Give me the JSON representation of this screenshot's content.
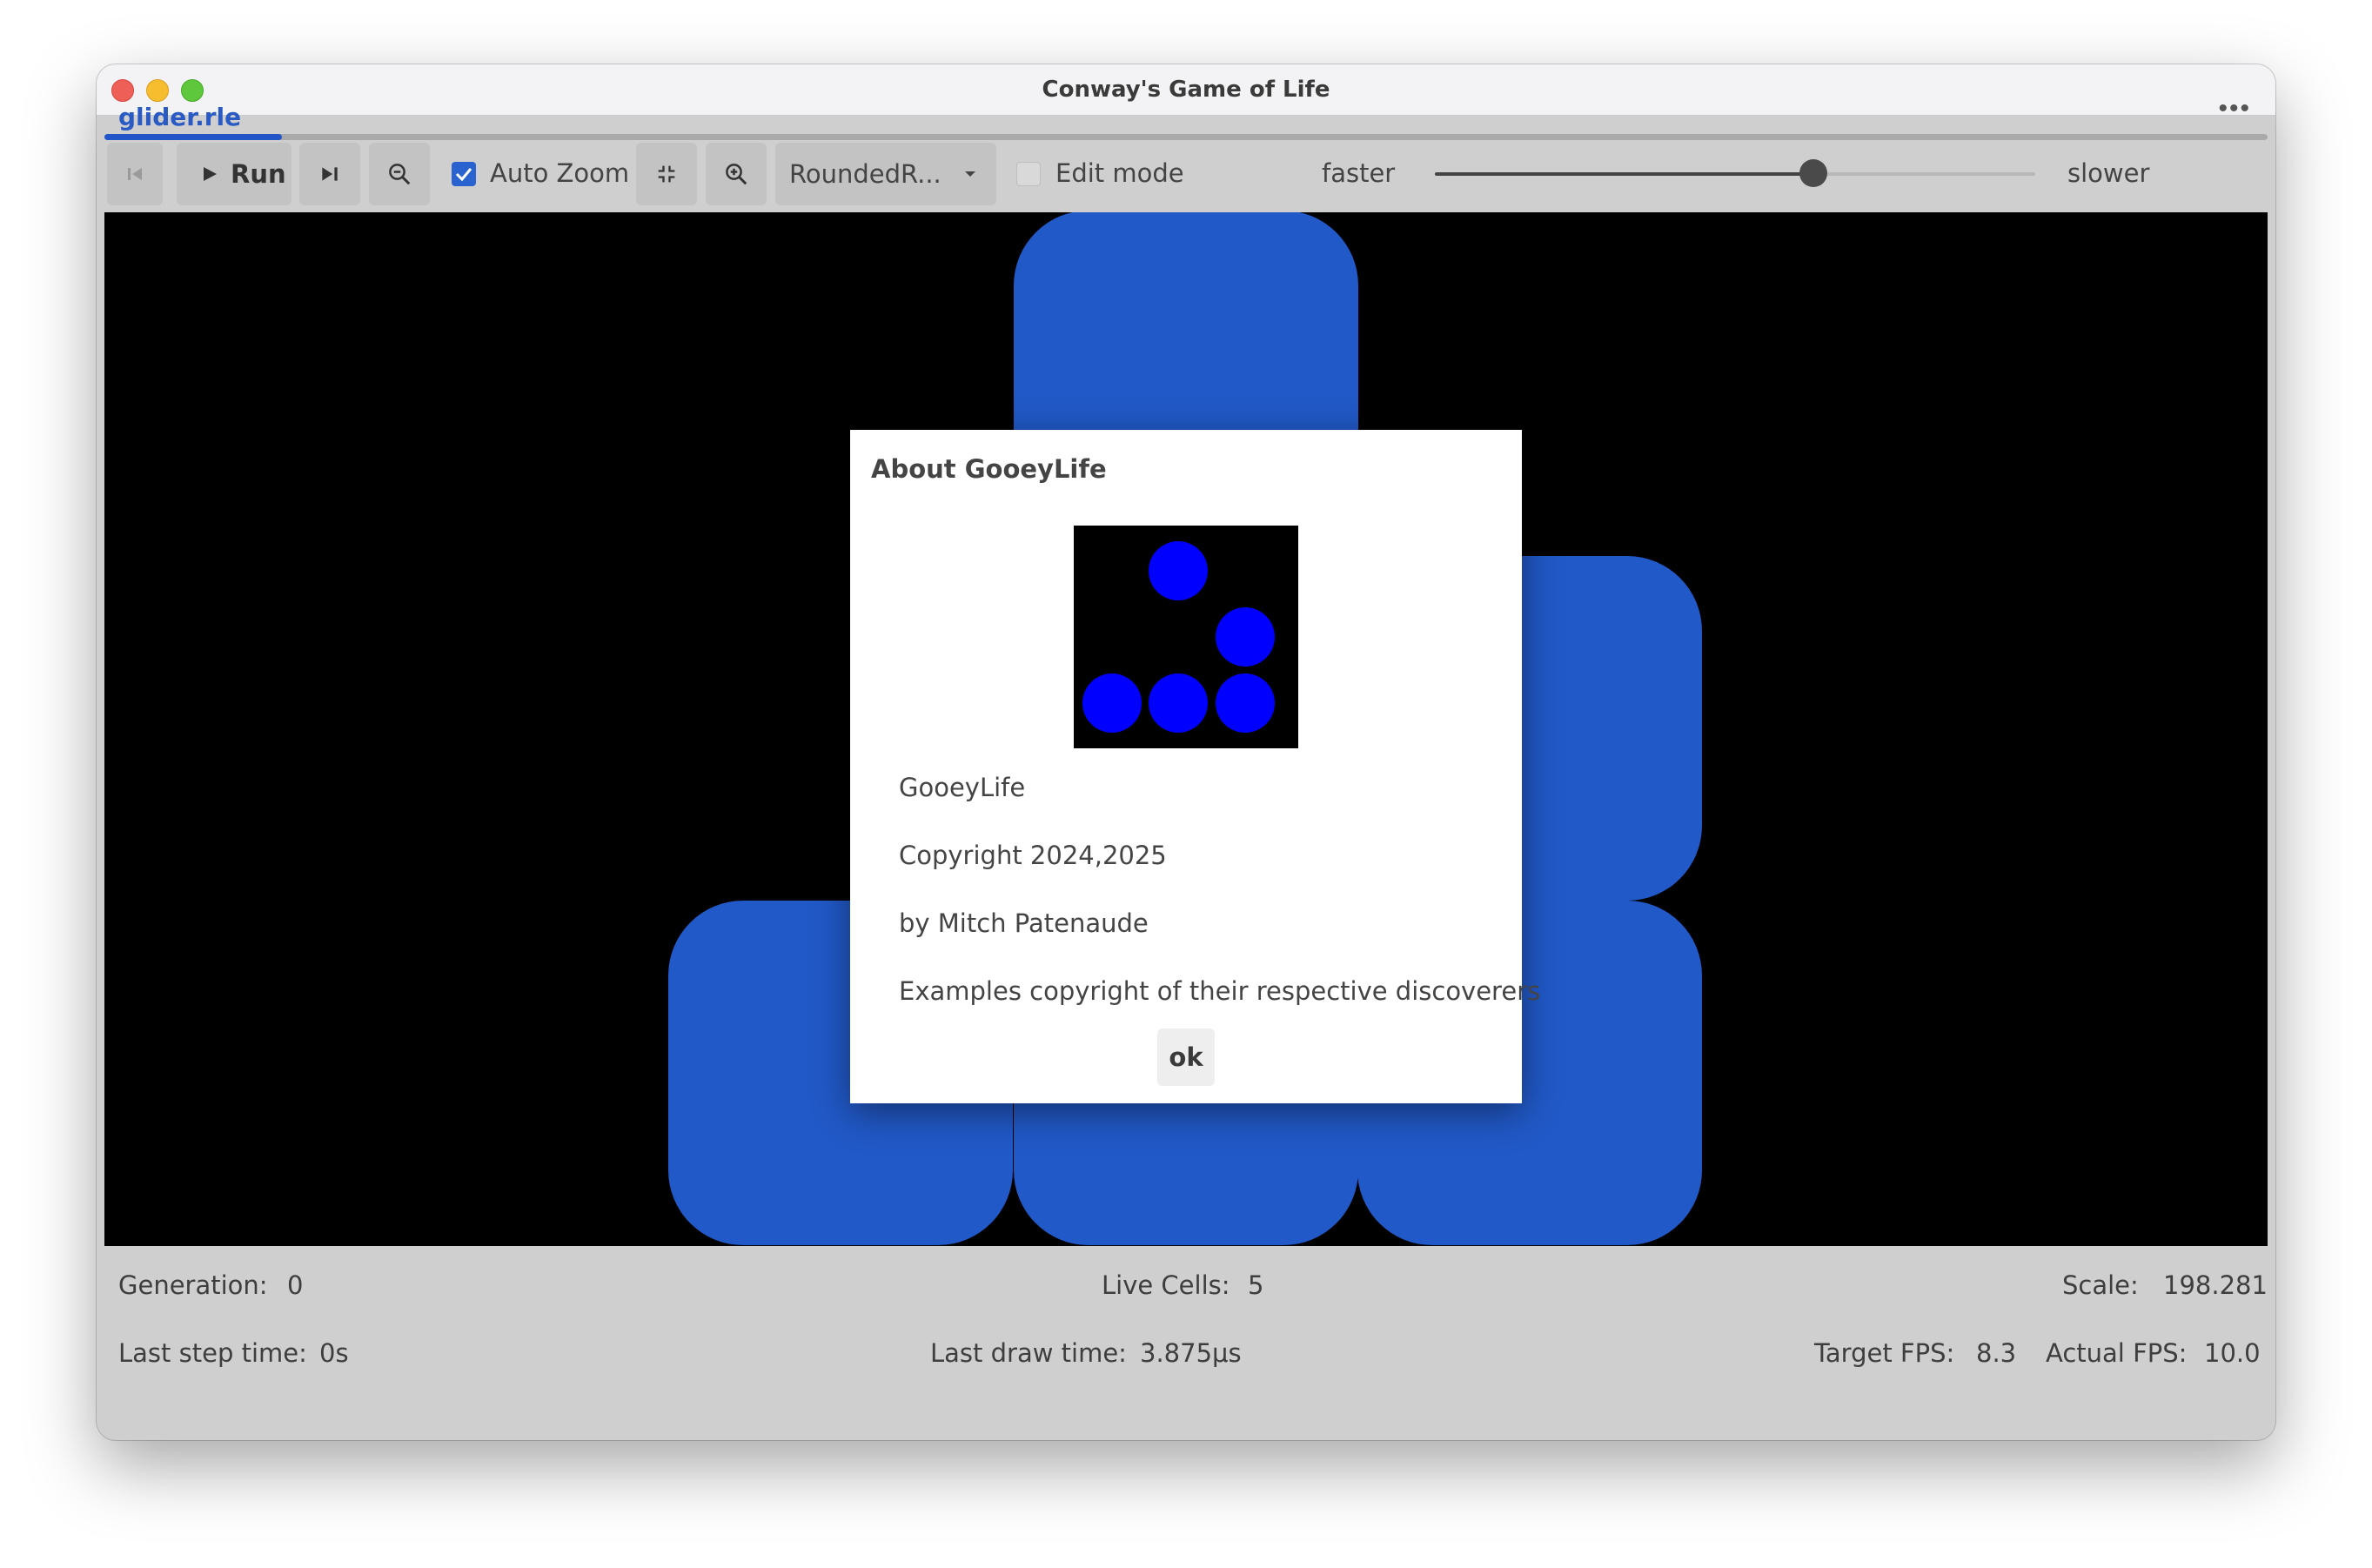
{
  "window": {
    "title": "Conway's Game of Life"
  },
  "tab": {
    "label": "glider.rle",
    "more_icon": "more-horizontal-icon"
  },
  "toolbar": {
    "run_label": "Run",
    "auto_zoom_label": "Auto Zoom",
    "auto_zoom_checked": true,
    "renderer_value": "RoundedR...",
    "edit_mode_label": "Edit mode",
    "edit_mode_checked": false,
    "faster_label": "faster",
    "slower_label": "slower",
    "speed_fraction": 0.63
  },
  "colors": {
    "accent": "#2256c8",
    "cell": "#2159c8",
    "logo_cell": "#0000ff",
    "canvas": "#000000"
  },
  "status": {
    "generation_label": "Generation:",
    "generation_value": "0",
    "live_cells_label": "Live Cells:",
    "live_cells_value": "5",
    "scale_label": "Scale:",
    "scale_value": "198.281",
    "last_step_label": "Last step time:",
    "last_step_value": "0s",
    "last_draw_label": "Last draw time:",
    "last_draw_value": "3.875μs",
    "target_fps_label": "Target FPS:",
    "target_fps_value": "8.3",
    "actual_fps_label": "Actual FPS:",
    "actual_fps_value": "10.0"
  },
  "dialog": {
    "title": "About GooeyLife",
    "app_name": "GooeyLife",
    "copyright": "Copyright 2024,2025",
    "author": "by Mitch Patenaude",
    "examples": "Examples copyright of their respective discoverers",
    "ok_label": "ok"
  }
}
